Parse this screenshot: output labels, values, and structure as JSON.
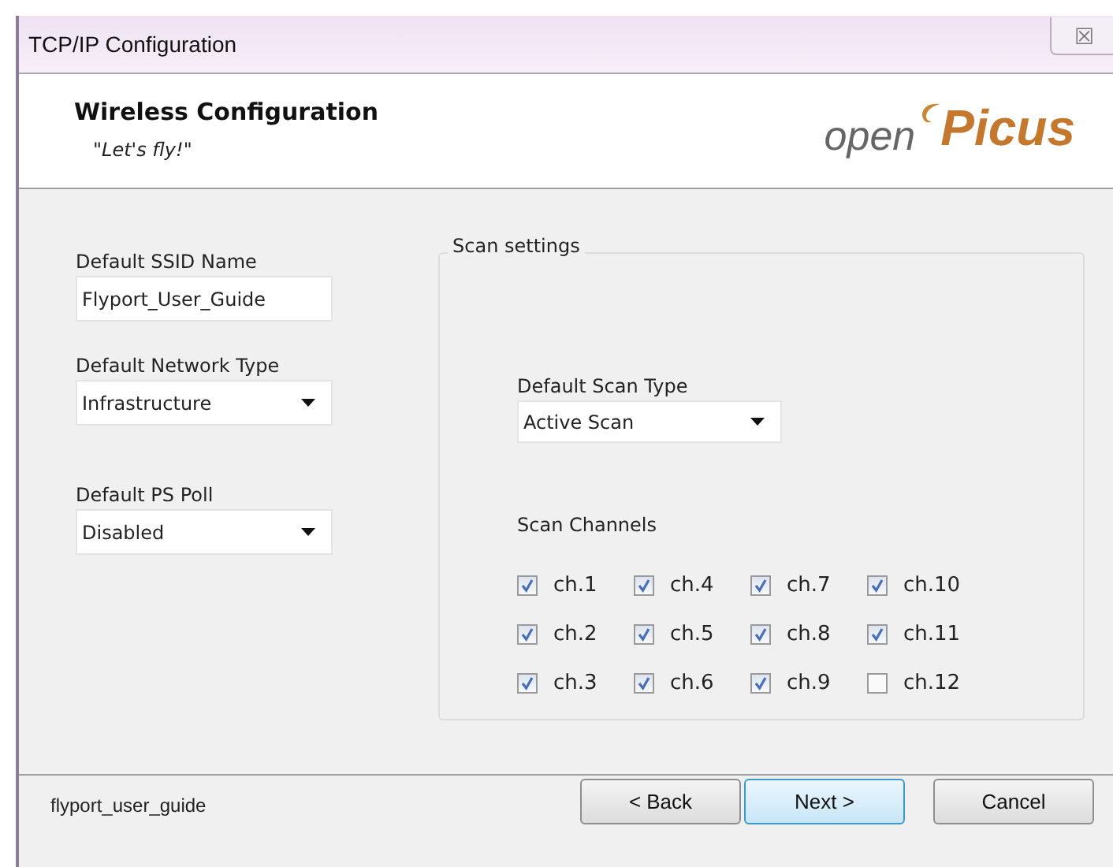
{
  "window": {
    "title": "TCP/IP Configuration",
    "close": "☒"
  },
  "header": {
    "title": "Wireless Configuration",
    "subtitle": "\"Let's fly!\"",
    "logo": {
      "prefix": "open",
      "name": "Picus"
    }
  },
  "fields": [
    {
      "label": "Default SSID Name",
      "kind": "text",
      "value": "Flyport_User_Guide"
    },
    {
      "label": "Default Network Type",
      "kind": "select",
      "value": "Infrastructure"
    },
    {
      "label": "Default PS Poll",
      "kind": "select",
      "value": "Disabled"
    }
  ],
  "scan_settings": {
    "title": "Scan settings",
    "scan_type": {
      "label": "Default Scan Type",
      "value": "Active Scan"
    },
    "channels_label": "Scan Channels",
    "channels": [
      {
        "label": "ch.1",
        "checked": true
      },
      {
        "label": "ch.2",
        "checked": true
      },
      {
        "label": "ch.3",
        "checked": true
      },
      {
        "label": "ch.4",
        "checked": true
      },
      {
        "label": "ch.5",
        "checked": true
      },
      {
        "label": "ch.6",
        "checked": true
      },
      {
        "label": "ch.7",
        "checked": true
      },
      {
        "label": "ch.8",
        "checked": true
      },
      {
        "label": "ch.9",
        "checked": true
      },
      {
        "label": "ch.10",
        "checked": true
      },
      {
        "label": "ch.11",
        "checked": true
      },
      {
        "label": "ch.12",
        "checked": false
      }
    ]
  },
  "footer": {
    "text": "flyport_user_guide",
    "buttons": [
      {
        "label": "< Back",
        "focused": false
      },
      {
        "label": "Next >",
        "focused": true
      },
      {
        "label": "Cancel",
        "focused": false
      }
    ]
  }
}
